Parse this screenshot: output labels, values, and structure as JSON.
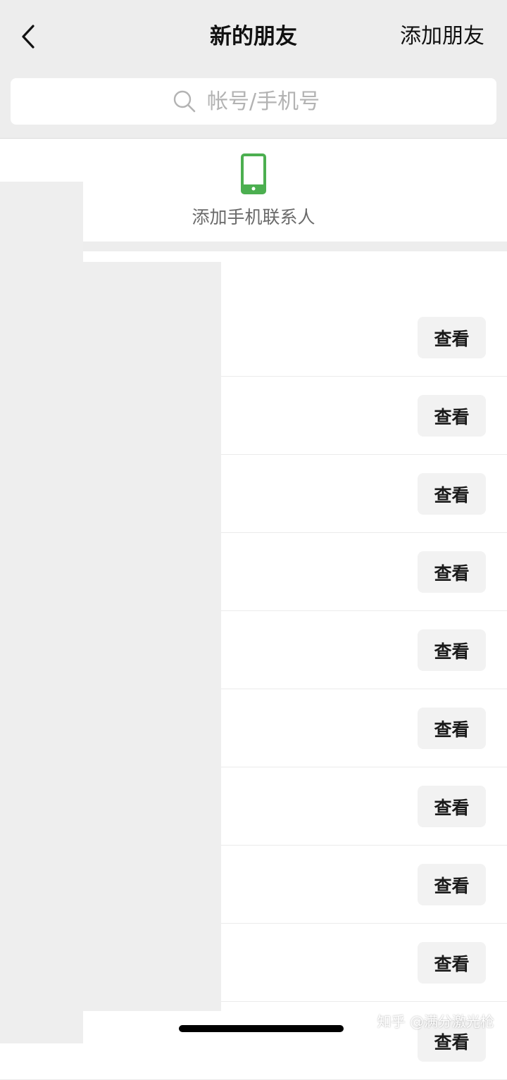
{
  "nav": {
    "back_icon": "chevron-left-icon",
    "title": "新的朋友",
    "add_friends_label": "添加朋友"
  },
  "search": {
    "icon": "search-icon",
    "placeholder": "帐号/手机号",
    "value": ""
  },
  "phone_contacts": {
    "icon": "mobile-phone-icon",
    "label": "添加手机联系人",
    "icon_color": "#4caf50"
  },
  "friend_requests": [
    {
      "button_label": "查看"
    },
    {
      "button_label": "查看"
    },
    {
      "button_label": "查看"
    },
    {
      "button_label": "查看"
    },
    {
      "button_label": "查看"
    },
    {
      "button_label": "查看"
    },
    {
      "button_label": "查看"
    },
    {
      "button_label": "查看"
    },
    {
      "button_label": "查看"
    },
    {
      "button_label": "查看"
    }
  ],
  "watermark": "知乎 @满分激光枪",
  "colors": {
    "nav_background": "#ededed",
    "button_background": "#f2f2f2",
    "accent_green": "#4caf50"
  }
}
